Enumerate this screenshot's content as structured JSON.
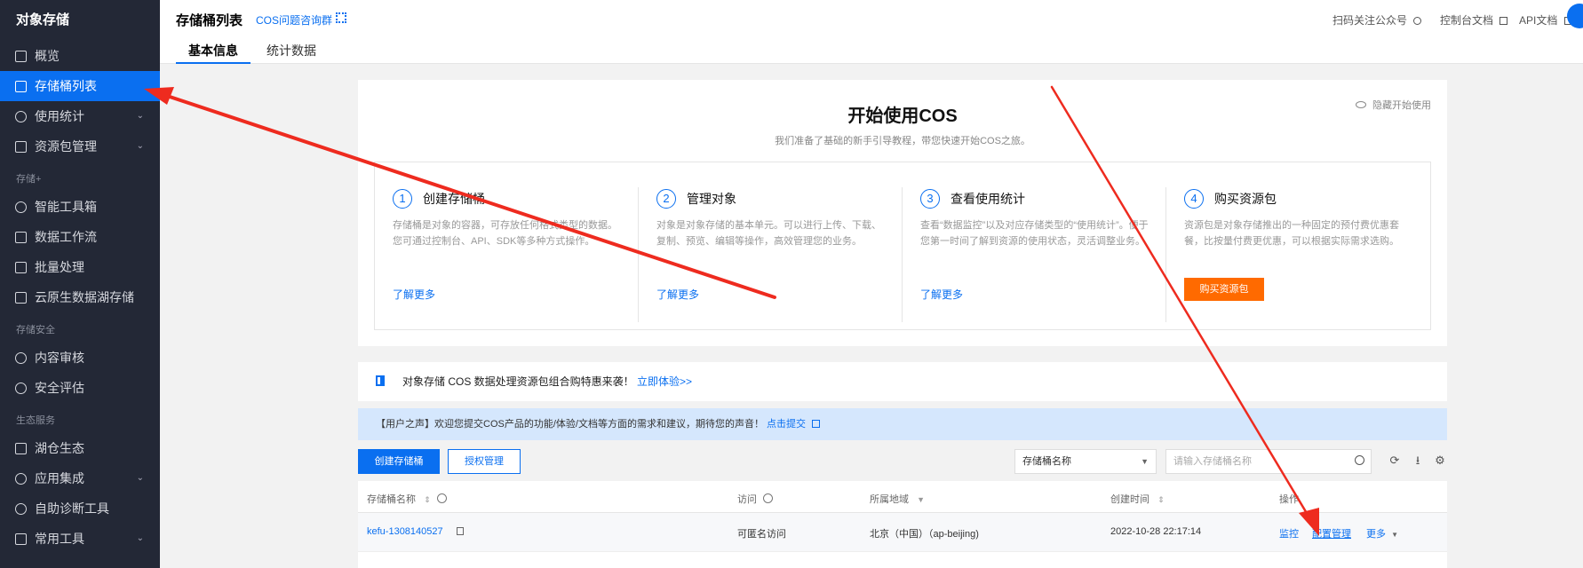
{
  "sidebar": {
    "app_title": "对象存储",
    "items": [
      {
        "label": "概览",
        "icon": "grid-icon"
      },
      {
        "label": "存储桶列表",
        "icon": "bucket-icon",
        "active": true
      },
      {
        "label": "使用统计",
        "icon": "pie-chart-icon",
        "expand": "⌄"
      },
      {
        "label": "资源包管理",
        "icon": "package-icon",
        "expand": "⌄"
      }
    ],
    "section_storage": "存储+",
    "storage_items": [
      {
        "label": "智能工具箱",
        "icon": "toolbox-icon"
      },
      {
        "label": "数据工作流",
        "icon": "workflow-icon"
      },
      {
        "label": "批量处理",
        "icon": "checkbox-icon"
      },
      {
        "label": "云原生数据湖存储",
        "icon": "datalake-icon"
      }
    ],
    "section_security": "存储安全",
    "security_items": [
      {
        "label": "内容审核",
        "icon": "audit-icon"
      },
      {
        "label": "安全评估",
        "icon": "shield-icon"
      }
    ],
    "section_eco": "生态服务",
    "eco_items": [
      {
        "label": "湖仓生态",
        "icon": "lakehouse-icon"
      },
      {
        "label": "应用集成",
        "icon": "integration-icon",
        "expand": "⌄"
      },
      {
        "label": "自助诊断工具",
        "icon": "diagnose-icon"
      },
      {
        "label": "常用工具",
        "icon": "tools-icon",
        "expand": "⌄"
      }
    ]
  },
  "header": {
    "title": "存储桶列表",
    "cos_group_link": "COS问题咨询群",
    "scan_follow": "扫码关注公众号",
    "console_docs": "控制台文档",
    "api_docs": "API文档",
    "tabs": [
      "基本信息",
      "统计数据"
    ]
  },
  "start_card": {
    "title": "开始使用COS",
    "subtitle": "我们准备了基础的新手引导教程，带您快速开始COS之旅。",
    "hide_label": "隐藏开始使用",
    "steps": [
      {
        "num": "1",
        "title": "创建存储桶",
        "desc": "存储桶是对象的容器，可存放任何格式类型的数据。您可通过控制台、API、SDK等多种方式操作。",
        "link": "了解更多"
      },
      {
        "num": "2",
        "title": "管理对象",
        "desc": "对象是对象存储的基本单元。可以进行上传、下载、复制、预览、编辑等操作，高效管理您的业务。",
        "link": "了解更多"
      },
      {
        "num": "3",
        "title": "查看使用统计",
        "desc": "查看“数据监控”以及对应存储类型的“使用统计”。便于您第一时间了解到资源的使用状态，灵活调整业务。",
        "link": "了解更多"
      },
      {
        "num": "4",
        "title": "购买资源包",
        "desc": "资源包是对象存储推出的一种固定的预付费优惠套餐，比按量付费更优惠，可以根据实际需求选购。",
        "button": "购买资源包"
      }
    ]
  },
  "promo": {
    "text": "对象存储 COS 数据处理资源包组合购特惠来袭！",
    "link": "立即体验>>"
  },
  "notice": {
    "text": "【用户之声】欢迎您提交COS产品的功能/体验/文档等方面的需求和建议，期待您的声音！",
    "link": "点击提交"
  },
  "toolbar": {
    "create_button": "创建存储桶",
    "auth_button": "授权管理",
    "filter_select": "存储桶名称",
    "search_placeholder": "请输入存储桶名称"
  },
  "table": {
    "headers": [
      "存储桶名称",
      "访问",
      "所属地域",
      "创建时间",
      "操作"
    ],
    "rows": [
      {
        "name": "kefu-1308140527",
        "access": "可匿名访问",
        "region": "北京（中国）（ap-beijing)",
        "created": "2022-10-28 22:17:14",
        "actions": [
          "监控",
          "配置管理",
          "更多"
        ]
      }
    ]
  },
  "colors": {
    "accent": "#0a6ff0",
    "sidebar_bg": "#232836",
    "buy_button": "#ff6a00",
    "annotation": "#ee2b1f"
  }
}
